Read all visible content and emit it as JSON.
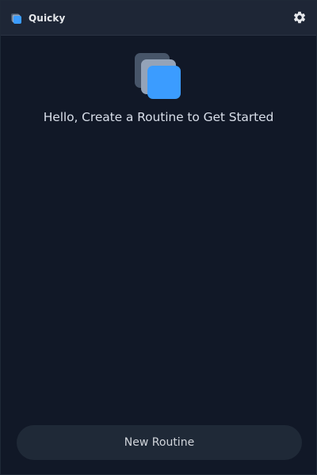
{
  "app": {
    "name": "Quicky",
    "logo_icon": "stacked-cards-icon",
    "settings_icon": "gear-icon"
  },
  "main": {
    "hero_icon": "stacked-cards-icon",
    "empty_state_title": "Hello, Create a Routine to Get Started"
  },
  "footer": {
    "new_routine_label": "New Routine"
  },
  "colors": {
    "background": "#111827",
    "titlebar": "#1e2636",
    "button": "#1f2937",
    "accent_blue": "#3b9cff",
    "card_slate": "#475569",
    "card_light": "#94a3b8"
  }
}
